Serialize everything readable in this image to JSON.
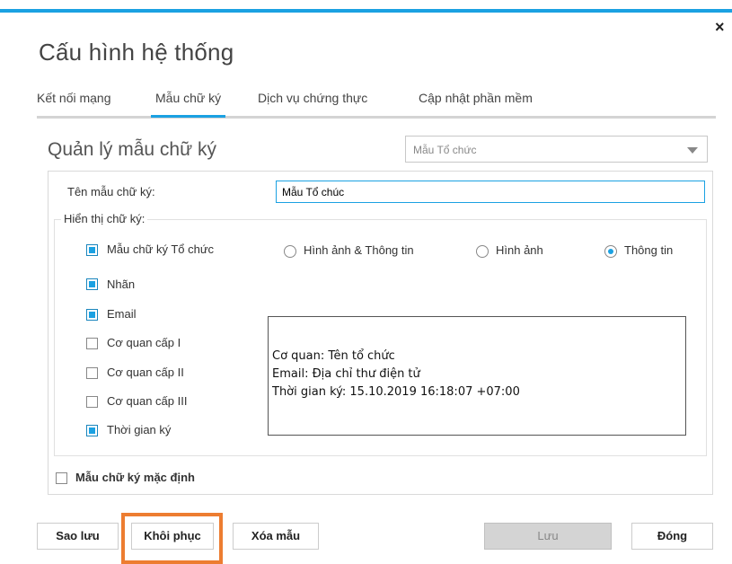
{
  "window": {
    "close_glyph": "×",
    "title": "Cấu hình hệ thống",
    "accent_color": "#1ba1e2",
    "highlight_color": "#ed7d31"
  },
  "tabs": [
    {
      "label": "Kết nối mạng",
      "active": false
    },
    {
      "label": "Mẫu chữ ký",
      "active": true
    },
    {
      "label": "Dịch vụ chứng thực",
      "active": false
    },
    {
      "label": "Cập nhật phần mềm",
      "active": false
    }
  ],
  "section": {
    "title": "Quản lý mẫu chữ ký",
    "template_select": {
      "value": "Mẫu Tổ chức"
    }
  },
  "form": {
    "name_label": "Tên mẫu chữ ký:",
    "name_value": "Mẫu Tổ chúc",
    "display_group_label": "Hiển thị chữ ký:"
  },
  "checkboxes": [
    {
      "label": "Mẫu chữ ký Tổ chức",
      "checked": true
    },
    {
      "label": "Nhãn",
      "checked": true
    },
    {
      "label": "Email",
      "checked": true
    },
    {
      "label": "Cơ quan cấp I",
      "checked": false
    },
    {
      "label": "Cơ quan cấp II",
      "checked": false
    },
    {
      "label": "Cơ quan cấp III",
      "checked": false
    },
    {
      "label": "Thời gian ký",
      "checked": true
    }
  ],
  "radios": [
    {
      "label": "Hình ảnh & Thông tin",
      "selected": false
    },
    {
      "label": "Hình ảnh",
      "selected": false
    },
    {
      "label": "Thông tin",
      "selected": true
    }
  ],
  "preview": {
    "lines": [
      "Cơ quan: Tên tổ chức",
      "Email: Địa chỉ thư điện tử",
      "Thời gian ký: 15.10.2019 16:18:07 +07:00"
    ]
  },
  "default_checkbox": {
    "label": "Mẫu chữ ký mặc định",
    "checked": false
  },
  "buttons": {
    "backup": "Sao lưu",
    "restore": "Khôi phục",
    "delete": "Xóa mẫu",
    "save": "Lưu",
    "close": "Đóng"
  }
}
